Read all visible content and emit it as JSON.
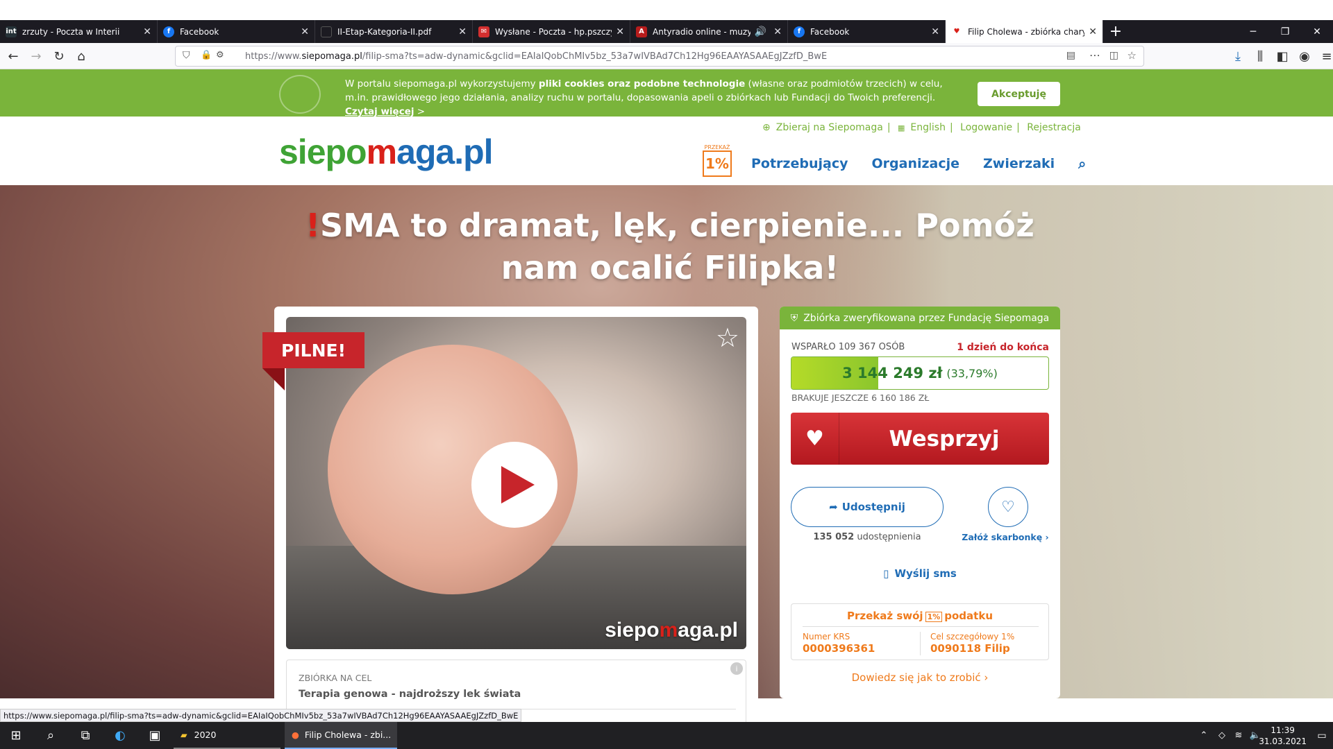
{
  "browser": {
    "tabs": [
      {
        "label": "zrzuty - Poczta w Interii",
        "fav_color": "#263238",
        "fav_glyph": "int"
      },
      {
        "label": "Facebook",
        "fav_color": "#1877f2",
        "fav_glyph": "f"
      },
      {
        "label": "II-Etap-Kategoria-II.pdf",
        "fav_color": "#1c1b22",
        "fav_glyph": ""
      },
      {
        "label": "Wysłane - Poczta - hp.pszczyna",
        "fav_color": "#d32f2f",
        "fav_glyph": "✉"
      },
      {
        "label": "Antyradio online - muzyczne",
        "fav_color": "#b71c1c",
        "fav_glyph": "A"
      },
      {
        "label": "Facebook",
        "fav_color": "#1877f2",
        "fav_glyph": "f"
      },
      {
        "label": "Filip Cholewa - zbiórka charytatywna",
        "fav_color": "#ffffff",
        "fav_glyph": "♥",
        "active": true
      }
    ],
    "url_prefix": "https://www.",
    "url_domain": "siepomaga.pl",
    "url_rest": "/filip-sma?ts=adw-dynamic&gclid=EAIaIQobChMIv5bz_53a7wIVBAd7Ch12Hg96EAAYASAAEgJZzfD_BwE",
    "status_url": "https://www.siepomaga.pl/filip-sma?ts=adw-dynamic&gclid=EAIaIQobChMIv5bz_53a7wIVBAd7Ch12Hg96EAAYASAAEgJZzfD_BwE"
  },
  "cookie": {
    "text_a": "W portalu siepomaga.pl wykorzystujemy ",
    "text_bold": "pliki cookies oraz podobne technologie",
    "text_b": " (własne oraz podmiotów trzecich) w celu, m.in. prawidłowego jego działania, analizy ruchu w portalu, dopasowania apeli o zbiórkach lub Fundacji do Twoich preferencji. ",
    "link": "Czytaj więcej",
    "link_arrow": " >",
    "accept": "Akceptuję"
  },
  "header": {
    "logo_a": "siepo",
    "logo_b": "m",
    "logo_c": "aga.pl",
    "links": [
      "Zbieraj na Siepomaga",
      "English",
      "Logowanie",
      "Rejestracja"
    ],
    "przekaz": "PRZEKAŻ",
    "one_pct": "1%",
    "nav": [
      "Potrzebujący",
      "Organizacje",
      "Zwierzaki"
    ]
  },
  "campaign": {
    "title_mark": "!",
    "title": "SMA to dramat, lęk, cierpienie... Pomóż nam ocalić Filipka!",
    "pilne": "PILNE!",
    "watermark_a": "siepo",
    "watermark_b": "m",
    "watermark_c": "aga.pl",
    "zbiorka_label": "ZBIÓRKA NA CEL",
    "zbiorka_value": "Terapia genowa - najdroższy lek świata",
    "info_i": "i"
  },
  "sidebar": {
    "verified": "Zbiórka zweryfikowana przez Fundację Siepomaga",
    "supporters": "WSPARŁO 109 367 OSÓB",
    "days_left": "1 dzień do końca",
    "amount": "3 144 249 zł",
    "percent_text": "(33,79%)",
    "progress": 0.3379,
    "missing": "BRAKUJE JESZCZE 6 160 186 ZŁ",
    "support_button": "Wesprzyj",
    "share_button": "Udostępnij",
    "share_count_bold": "135 052",
    "share_count_rest": " udostępnienia",
    "piggy_label": "Załóż skarbonkę",
    "sms": "Wyślij sms",
    "tax_a": "Przekaż swój",
    "tax_badge": "1%",
    "tax_b": "podatku",
    "krs_label": "Numer KRS",
    "krs_value": "0000396361",
    "cel_label": "Cel szczegółowy 1%",
    "cel_value": "0090118 Filip",
    "learn_more": "Dowiedz się jak to zrobić"
  },
  "taskbar": {
    "apps": [
      {
        "label": "2020"
      },
      {
        "label": "Filip Cholewa - zbi..."
      }
    ],
    "time": "11:39",
    "date": "31.03.2021"
  },
  "colors": {
    "green": "#7ab43b",
    "blue": "#1f6cb5",
    "red": "#c7252b",
    "orange": "#ef7a1b"
  }
}
